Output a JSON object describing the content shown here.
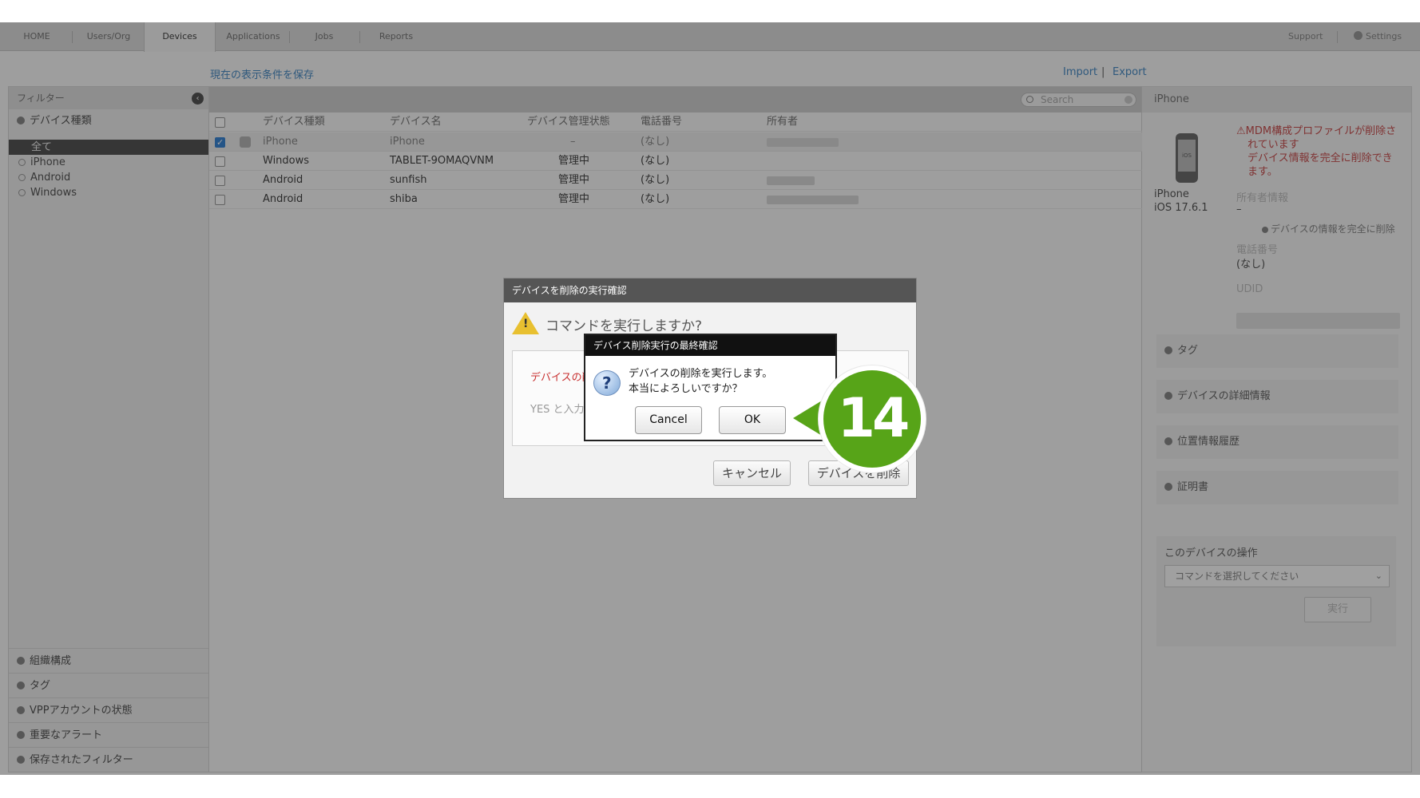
{
  "nav": {
    "tabs": [
      "HOME",
      "Users/Org",
      "Devices",
      "Applications",
      "Jobs",
      "Reports"
    ],
    "active_tab": "Devices",
    "support": "Support",
    "settings": "Settings"
  },
  "toolbar": {
    "save_view": "現在の表示条件を保存",
    "import": "Import",
    "separator": "|",
    "export": "Export"
  },
  "sidebar": {
    "header": "フィルター",
    "section_device_type": "デバイス種類",
    "items": [
      "全て",
      "iPhone",
      "Android",
      "Windows"
    ],
    "bottom": [
      "組織構成",
      "タグ",
      "VPPアカウントの状態",
      "重要なアラート",
      "保存されたフィルター"
    ]
  },
  "search": {
    "placeholder": "Search"
  },
  "table": {
    "headers": [
      "デバイス種類",
      "デバイス名",
      "デバイス管理状態",
      "電話番号",
      "所有者"
    ],
    "rows": [
      {
        "type": "iPhone",
        "name": "iPhone",
        "status": "–",
        "phone": "(なし)",
        "checked": true
      },
      {
        "type": "Windows",
        "name": "TABLET-9OMAQVNM",
        "status": "管理中",
        "phone": "(なし)",
        "checked": false
      },
      {
        "type": "Android",
        "name": "sunfish",
        "status": "管理中",
        "phone": "(なし)",
        "checked": false
      },
      {
        "type": "Android",
        "name": "shiba",
        "status": "管理中",
        "phone": "(なし)",
        "checked": false
      }
    ]
  },
  "detail": {
    "title": "iPhone",
    "device_icon_label": "iOS",
    "device_name": "iPhone",
    "os_version": "iOS 17.6.1",
    "alert_line1": "⚠MDM構成プロファイルが削除さ",
    "alert_line2": "れています",
    "alert_line3": "デバイス情報を完全に削除でき",
    "alert_line4": "ます。",
    "owner_label": "所有者情報",
    "owner_value": "–",
    "wipe_link": "デバイスの情報を完全に削除",
    "phone_label": "電話番号",
    "phone_value": "(なし)",
    "udid_label": "UDID",
    "accordions": [
      "タグ",
      "デバイスの詳細情報",
      "位置情報履歴",
      "証明書"
    ],
    "ops_title": "このデバイスの操作",
    "ops_select": "コマンドを選択してください",
    "ops_run": "実行"
  },
  "dialog_outer": {
    "title": "デバイスを削除の実行確認",
    "question": "コマンドを実行しますか?",
    "red_text": "デバイスの削",
    "hint": "YES と入力",
    "cancel": "キャンセル",
    "delete": "デバイスを削除"
  },
  "dialog_inner": {
    "title": "デバイス削除実行の最終確認",
    "line1": "デバイスの削除を実行します。",
    "line2": "本当によろしいですか？",
    "cancel": "Cancel",
    "ok": "OK"
  },
  "step_badge": "14",
  "colors": {
    "badge_green": "#57a418",
    "link_blue": "#4a8bc4",
    "alert_red": "#c85050",
    "checkbox_blue": "#3a86d4"
  },
  "icons": [
    "gear-icon",
    "collapse-left-icon",
    "search-icon",
    "clear-icon",
    "warning-icon",
    "question-icon",
    "iphone-icon",
    "chevron-down-icon"
  ]
}
